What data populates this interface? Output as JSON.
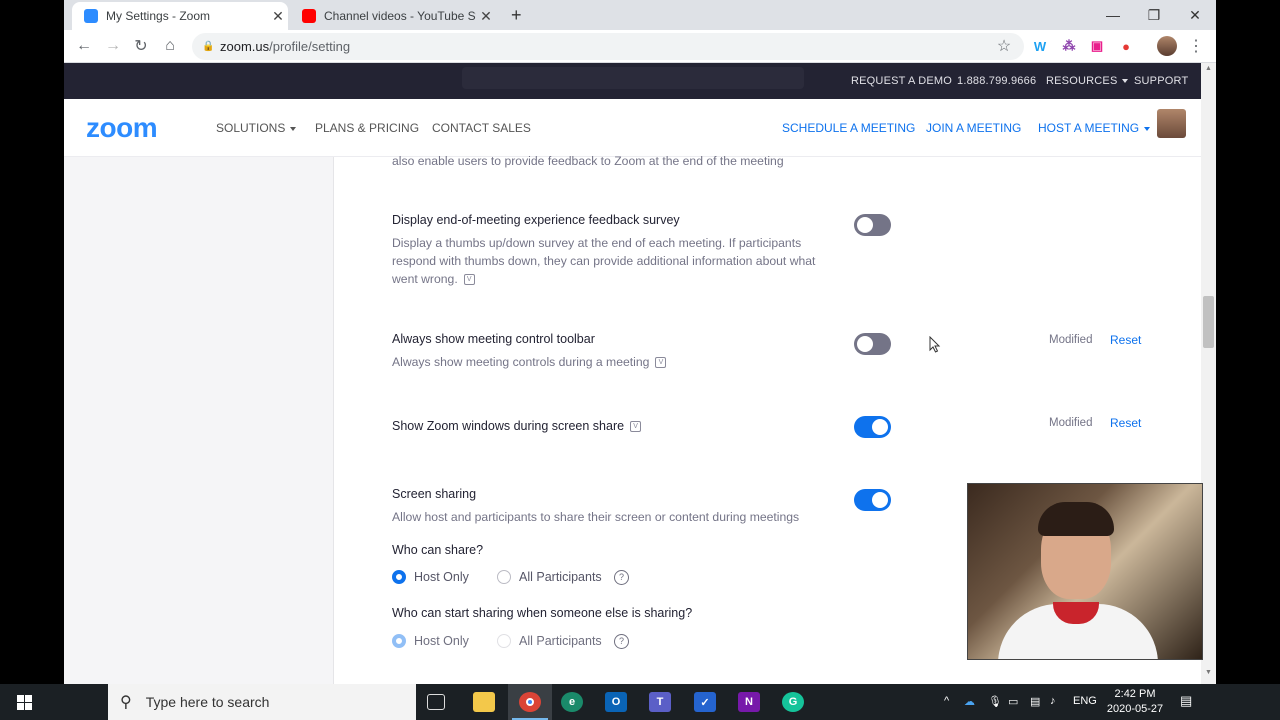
{
  "browser": {
    "tabs": [
      {
        "title": "My Settings - Zoom",
        "favicon_color": "#2d8cff",
        "active": true
      },
      {
        "title": "Channel videos - YouTube Studio",
        "favicon_color": "#ff0000",
        "active": false
      }
    ],
    "new_tab_glyph": "+",
    "window_controls": {
      "minimize": "—",
      "maximize": "❐",
      "close": "✕"
    },
    "url_host": "zoom.us",
    "url_path": "/profile/setting",
    "icons": [
      "back-icon",
      "forward-icon",
      "reload-icon",
      "home-icon",
      "lock-icon",
      "star-icon",
      "menu-dots-icon"
    ],
    "extensions": [
      {
        "name": "w-extension-icon",
        "glyph": "W",
        "color": "#1da1f2"
      },
      {
        "name": "dots-extension-icon",
        "glyph": "⁂",
        "color": "#8e44ad"
      },
      {
        "name": "square-extension-icon",
        "glyph": "▣",
        "color": "#e91e8c"
      },
      {
        "name": "record-extension-icon",
        "glyph": "●",
        "color": "#e53935"
      }
    ]
  },
  "zoom": {
    "topbar": {
      "request_demo": "REQUEST A DEMO",
      "phone": "1.888.799.9666",
      "resources": "RESOURCES",
      "support": "SUPPORT"
    },
    "nav": {
      "logo": "zoom",
      "solutions": "SOLUTIONS",
      "plans": "PLANS & PRICING",
      "contact": "CONTACT SALES",
      "schedule": "SCHEDULE A MEETING",
      "join": "JOIN A MEETING",
      "host": "HOST A MEETING"
    },
    "colors": {
      "brand_blue": "#2d8cff",
      "link_blue": "#0e72ed",
      "toggle_off": "#747487",
      "dark_bar": "#232333"
    }
  },
  "settings": {
    "partial_desc": "also enable users to provide feedback to Zoom at the end of the meeting",
    "items": [
      {
        "title": "Display end-of-meeting experience feedback survey",
        "desc": "Display a thumbs up/down survey at the end of each meeting. If participants respond with thumbs down, they can provide additional information about what went wrong.",
        "enabled": false
      },
      {
        "title": "Always show meeting control toolbar",
        "desc": "Always show meeting controls during a meeting",
        "enabled": false,
        "modified": "Modified",
        "reset": "Reset"
      },
      {
        "title": "Show Zoom windows during screen share",
        "enabled": true,
        "modified": "Modified",
        "reset": "Reset"
      },
      {
        "title": "Screen sharing",
        "desc": "Allow host and participants to share their screen or content during meetings",
        "enabled": true
      }
    ],
    "who_can_share": {
      "question": "Who can share?",
      "options": [
        "Host Only",
        "All Participants"
      ],
      "selected": "Host Only"
    },
    "who_can_start": {
      "question": "Who can start sharing when someone else is sharing?",
      "options": [
        "Host Only",
        "All Participants"
      ],
      "selected": "Host Only"
    },
    "help_glyph": "?",
    "v_glyph": "V"
  },
  "taskbar": {
    "search_placeholder": "Type here to search",
    "apps": [
      {
        "name": "task-view-icon",
        "glyph": "⧉",
        "color": "#1b2024"
      },
      {
        "name": "file-explorer-icon",
        "glyph": "▬",
        "color": "#f3c84a"
      },
      {
        "name": "chrome-icon",
        "glyph": "◉",
        "color": "#db4437"
      },
      {
        "name": "edge-icon",
        "glyph": "e",
        "color": "#1a8a6a"
      },
      {
        "name": "outlook-icon",
        "glyph": "O",
        "color": "#0a64b6"
      },
      {
        "name": "teams-icon",
        "glyph": "T",
        "color": "#5b5fc7"
      },
      {
        "name": "todo-icon",
        "glyph": "✓",
        "color": "#2564cf"
      },
      {
        "name": "onenote-icon",
        "glyph": "N",
        "color": "#7719aa"
      },
      {
        "name": "grammarly-icon",
        "glyph": "G",
        "color": "#15c39a"
      }
    ],
    "language": "ENG",
    "time": "2:42 PM",
    "date": "2020-05-27"
  }
}
